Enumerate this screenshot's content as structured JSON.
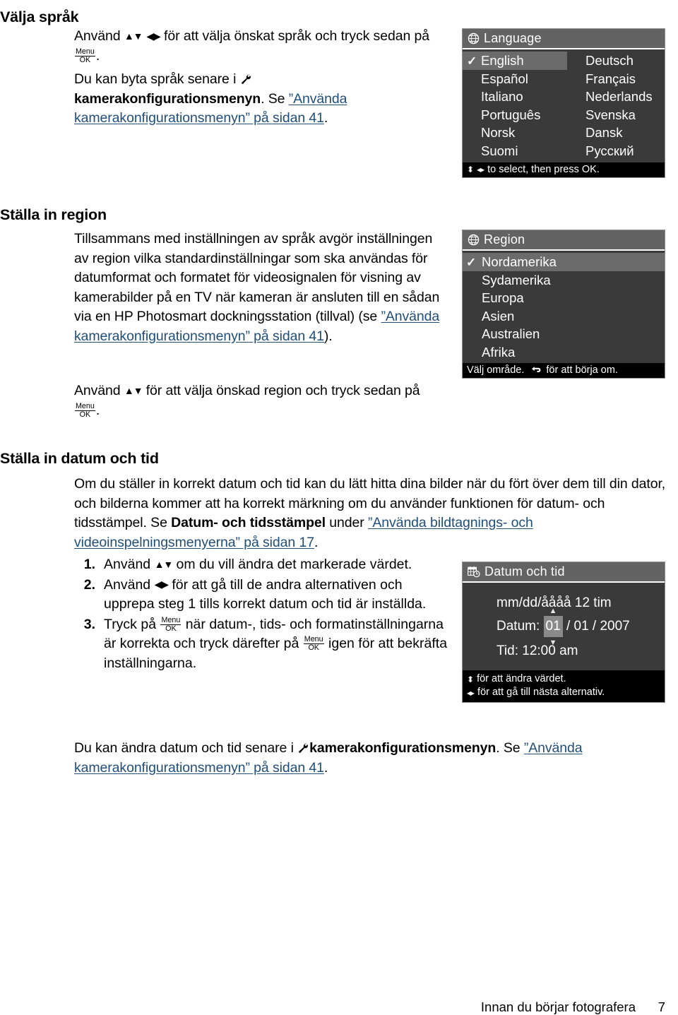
{
  "sections": {
    "language": {
      "heading": "Välja språk",
      "para1_a": "Använd ",
      "para1_b": " för att välja önskat språk och tryck sedan på ",
      "para1_c": ".",
      "para2_a": "Du kan byta språk senare i ",
      "para2_bold": "kamerakonfigurationsmenyn",
      "para2_b": ". Se ",
      "para2_link": "”Använda kamerakonfigurationsmenyn” på sidan 41",
      "para2_c": "."
    },
    "region": {
      "heading": "Ställa in region",
      "para1_a": "Tillsammans med inställningen av språk avgör inställningen av region vilka standardinställningar som ska användas för datumformat och formatet för videosignalen för visning av kamerabilder på en TV när kameran är ansluten till en sådan via en HP Photosmart dockningsstation (tillval) (se ",
      "para1_link": "”Använda kamerakonfigurationsmenyn” på sidan 41",
      "para1_c": ").",
      "para2_a": "Använd ",
      "para2_b": " för att välja önskad region och tryck sedan på ",
      "para2_c": "."
    },
    "datetime": {
      "heading": "Ställa in datum och tid",
      "para1_a": "Om du ställer in korrekt datum och tid kan du lätt hitta dina bilder när du fört över dem till din dator, och bilderna kommer att ha korrekt märkning om du använder funktionen för datum- och tidsstämpel. Se ",
      "para1_bold": "Datum- och tidsstämpel",
      "para1_b": " under ",
      "para1_link": "”Använda bildtagnings- och videoinspelningsmenyerna” på sidan 17",
      "para1_c": ".",
      "steps": [
        {
          "num": "1.",
          "a": "Använd ",
          "b": " om du vill ändra det markerade värdet."
        },
        {
          "num": "2.",
          "a": "Använd ",
          "b": " för att gå till de andra alternativen och upprepa steg 1 tills korrekt datum och tid är inställda."
        },
        {
          "num": "3.",
          "a": "Tryck på ",
          "b": " när datum-, tids- och formatinställningarna är korrekta och tryck därefter på ",
          "c": " igen för att bekräfta inställningarna."
        }
      ],
      "para2_a": "Du kan ändra datum och tid senare i ",
      "para2_bold": "kamerakonfigurationsmenyn",
      "para2_b": ". Se ",
      "para2_link": "”Använda kamerakonfigurationsmenyn” på sidan 41",
      "para2_c": "."
    }
  },
  "screens": {
    "language": {
      "title": "Language",
      "title_icon": "globe-icon",
      "check_mark": "✓",
      "items": [
        {
          "label": "English",
          "selected": true,
          "col": 1
        },
        {
          "label": "Deutsch",
          "selected": false,
          "col": 2
        },
        {
          "label": "Español",
          "selected": false,
          "col": 1
        },
        {
          "label": "Français",
          "selected": false,
          "col": 2
        },
        {
          "label": "Italiano",
          "selected": false,
          "col": 1
        },
        {
          "label": "Nederlands",
          "selected": false,
          "col": 2
        },
        {
          "label": "Português",
          "selected": false,
          "col": 1
        },
        {
          "label": "Svenska",
          "selected": false,
          "col": 2
        },
        {
          "label": "Norsk",
          "selected": false,
          "col": 1
        },
        {
          "label": "Dansk",
          "selected": false,
          "col": 2
        },
        {
          "label": "Suomi",
          "selected": false,
          "col": 1
        },
        {
          "label": "Русский",
          "selected": false,
          "col": 2
        }
      ],
      "footer": "to select, then press OK."
    },
    "region": {
      "title": "Region",
      "title_icon": "globe-icon",
      "check_mark": "✓",
      "items": [
        {
          "label": "Nordamerika",
          "selected": true
        },
        {
          "label": "Sydamerika",
          "selected": false
        },
        {
          "label": "Europa",
          "selected": false
        },
        {
          "label": "Asien",
          "selected": false
        },
        {
          "label": "Australien",
          "selected": false
        },
        {
          "label": "Afrika",
          "selected": false
        }
      ],
      "footer_a": "Välj område.",
      "footer_b": "för att börja om."
    },
    "datetime": {
      "title": "Datum och tid",
      "title_icon": "calendar-clock-icon",
      "format_row": "mm/dd/åååå  12 tim",
      "date_label": "Datum:",
      "date_month": "01",
      "date_rest": "/ 01 / 2007",
      "time_label": "Tid:",
      "time_value": "12:00  am",
      "footer_line1": "för att ändra värdet.",
      "footer_line2": "för att gå till nästa alternativ."
    }
  },
  "page_footer": {
    "text": "Innan du börjar fotografera",
    "number": "7"
  },
  "colors": {
    "link": "#1f4e79",
    "lcd_titlebar": "#636363",
    "lcd_body": "#3a3a3a",
    "lcd_footer": "#000000",
    "lcd_highlight": "#6b6b6b"
  }
}
